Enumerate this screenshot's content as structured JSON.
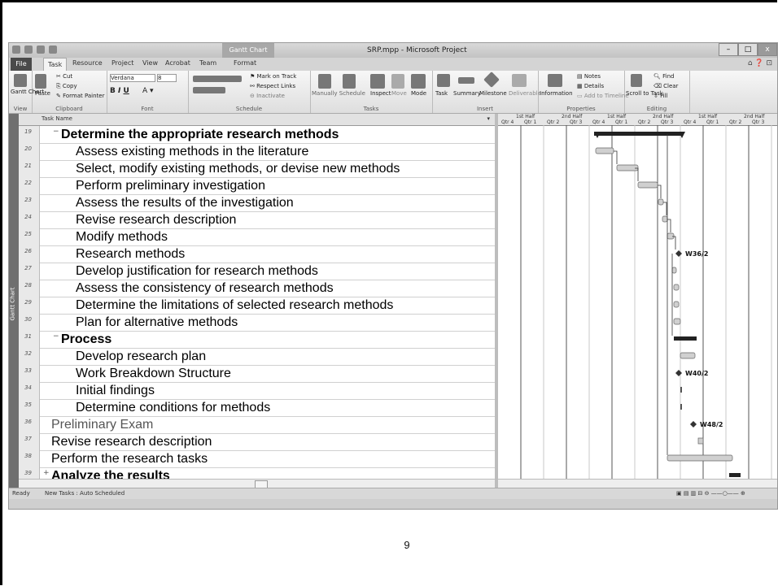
{
  "window": {
    "title": "SRP.mpp - Microsoft Project",
    "context_tab": "Gantt Chart Tools"
  },
  "tabs": [
    "File",
    "Task",
    "Resource",
    "Project",
    "View",
    "Acrobat",
    "Team",
    "Format"
  ],
  "tab_keys": [
    "F",
    "H",
    "U",
    "R",
    "W",
    "B",
    "Y",
    "P"
  ],
  "ribbon": {
    "view": {
      "gantt": "Gantt Chart",
      "group": "View"
    },
    "clipboard": {
      "paste": "Paste",
      "cut": "Cut",
      "copy": "Copy",
      "format_painter": "Format Painter",
      "group": "Clipboard"
    },
    "font": {
      "name": "Verdana",
      "size": "8",
      "group": "Font"
    },
    "schedule": {
      "mark": "Mark on Track",
      "respect": "Respect Links",
      "inactivate": "Inactivate",
      "group": "Schedule"
    },
    "tasks": {
      "manual": "Manually Schedule",
      "auto": "Auto Schedule",
      "inspect": "Inspect",
      "move": "Move",
      "mode": "Mode",
      "group": "Tasks"
    },
    "insert": {
      "task": "Task",
      "summary": "Summary",
      "milestone": "Milestone",
      "deliverable": "Deliverable",
      "group": "Insert"
    },
    "properties": {
      "information": "Information",
      "notes": "Notes",
      "details": "Details",
      "timeline": "Add to Timeline",
      "group": "Properties"
    },
    "editing": {
      "scroll": "Scroll to Task",
      "find": "Find",
      "clear": "Clear",
      "fill": "Fill",
      "group": "Editing"
    }
  },
  "grid": {
    "header": "Task Name",
    "rows": [
      {
        "id": "19",
        "name": "Determine the appropriate research methods",
        "style": "bold",
        "indent": 1,
        "collapse": "−"
      },
      {
        "id": "20",
        "name": "Assess existing methods in the literature",
        "style": "normal",
        "indent": 2
      },
      {
        "id": "21",
        "name": "Select, modify existing methods, or devise new methods",
        "style": "normal",
        "indent": 2
      },
      {
        "id": "22",
        "name": "Perform preliminary investigation",
        "style": "normal",
        "indent": 2
      },
      {
        "id": "23",
        "name": "Assess the results of the investigation",
        "style": "normal",
        "indent": 2
      },
      {
        "id": "24",
        "name": "Revise research description",
        "style": "normal",
        "indent": 2
      },
      {
        "id": "25",
        "name": "Modify methods",
        "style": "normal",
        "indent": 2
      },
      {
        "id": "26",
        "name": "Research methods",
        "style": "normal",
        "indent": 2
      },
      {
        "id": "27",
        "name": "Develop justification for research methods",
        "style": "normal",
        "indent": 2
      },
      {
        "id": "28",
        "name": "Assess the consistency of research methods",
        "style": "normal",
        "indent": 2
      },
      {
        "id": "29",
        "name": "Determine  the limitations of selected research methods",
        "style": "normal",
        "indent": 2
      },
      {
        "id": "30",
        "name": "Plan for alternative methods",
        "style": "normal",
        "indent": 2
      },
      {
        "id": "31",
        "name": "Process",
        "style": "bold",
        "indent": 1,
        "collapse": "−"
      },
      {
        "id": "32",
        "name": "Develop research plan",
        "style": "normal",
        "indent": 2
      },
      {
        "id": "33",
        "name": "Work Breakdown Structure",
        "style": "normal",
        "indent": 2
      },
      {
        "id": "34",
        "name": "Initial findings",
        "style": "normal",
        "indent": 2
      },
      {
        "id": "35",
        "name": "Determine conditions for methods",
        "style": "normal",
        "indent": 2
      },
      {
        "id": "36",
        "name": "Preliminary Exam",
        "style": "gray",
        "indent": 0
      },
      {
        "id": "37",
        "name": "Revise research description",
        "style": "normal",
        "indent": 0
      },
      {
        "id": "38",
        "name": "Perform the research tasks",
        "style": "normal",
        "indent": 0
      },
      {
        "id": "39",
        "name": "Analyze the results",
        "style": "bold",
        "indent": 0,
        "collapse": "+"
      }
    ]
  },
  "timescale": {
    "top": [
      "1st Half",
      "2nd Half",
      "1st Half",
      "2nd Half",
      "1st Half",
      "2nd Half"
    ],
    "bottom": [
      "Qtr 4",
      "Qtr 1",
      "Qtr 2",
      "Qtr 3",
      "Qtr 4",
      "Qtr 1",
      "Qtr 2",
      "Qtr 3",
      "Qtr 4",
      "Qtr 1",
      "Qtr 2",
      "Qtr 3"
    ]
  },
  "milestones": [
    {
      "row": "26",
      "label": "W36/2"
    },
    {
      "row": "33",
      "label": "W40/2"
    },
    {
      "row": "36",
      "label": "W48/2"
    }
  ],
  "status": {
    "ready": "Ready",
    "new_tasks": "New Tasks : Auto Scheduled"
  },
  "side_label": "Gantt Chart",
  "page_number": "9",
  "colors": {
    "bar": "#d0d0d0",
    "summary": "#222222",
    "grid_line": "#555555"
  }
}
